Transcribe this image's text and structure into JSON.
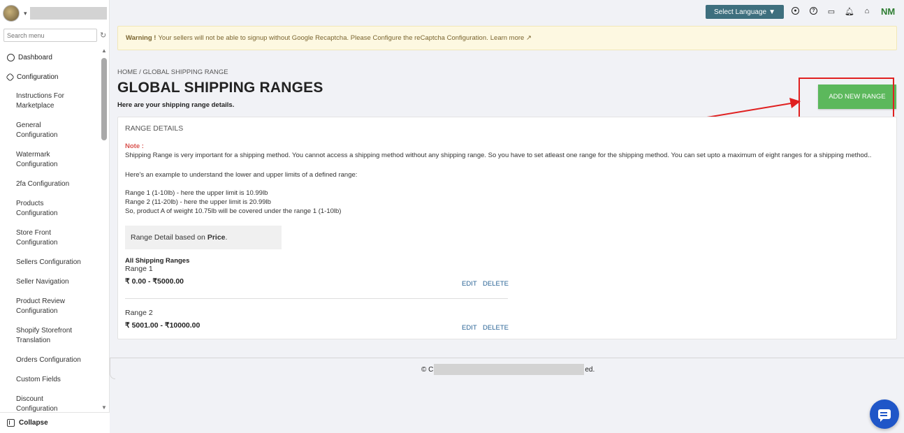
{
  "sidebar": {
    "search_placeholder": "Search menu",
    "items": [
      {
        "label": "Dashboard"
      },
      {
        "label": "Configuration"
      }
    ],
    "sub_items": [
      {
        "label": "Instructions For Marketplace",
        "lines": [
          "Instructions For",
          "Marketplace"
        ]
      },
      {
        "label": "General Configuration",
        "lines": [
          "General",
          "Configuration"
        ]
      },
      {
        "label": "Watermark Configuration",
        "lines": [
          "Watermark",
          "Configuration"
        ]
      },
      {
        "label": "2fa Configuration",
        "lines": [
          "2fa Configuration"
        ]
      },
      {
        "label": "Products Configuration",
        "lines": [
          "Products",
          "Configuration"
        ]
      },
      {
        "label": "Store Front Configuration",
        "lines": [
          "Store Front",
          "Configuration"
        ]
      },
      {
        "label": "Sellers Configuration",
        "lines": [
          "Sellers Configuration"
        ]
      },
      {
        "label": "Seller Navigation",
        "lines": [
          "Seller Navigation"
        ]
      },
      {
        "label": "Product Review Configuration",
        "lines": [
          "Product Review",
          "Configuration"
        ]
      },
      {
        "label": "Shopify Storefront Translation",
        "lines": [
          "Shopify Storefront",
          "Translation"
        ]
      },
      {
        "label": "Orders Configuration",
        "lines": [
          "Orders Configuration"
        ]
      },
      {
        "label": "Custom Fields",
        "lines": [
          "Custom Fields"
        ]
      },
      {
        "label": "Discount Configuration",
        "lines": [
          "Discount",
          "Configuration"
        ]
      }
    ],
    "collapse_label": "Collapse"
  },
  "topbar": {
    "language_label": "Select Language",
    "initials": "NM",
    "icons": [
      "account-circle-icon",
      "help-icon",
      "feedback-icon",
      "bell-icon",
      "store-icon"
    ]
  },
  "warning": {
    "strong": "Warning !",
    "text": "Your sellers will not be able to signup without Google Recaptcha. Please Configure the reCaptcha Configuration.",
    "link": "Learn more"
  },
  "page": {
    "breadcrumb_home": "HOME",
    "breadcrumb_sep": "/",
    "breadcrumb_current": "GLOBAL SHIPPING RANGE",
    "title": "GLOBAL SHIPPING RANGES",
    "subtitle": "Here are your shipping range details.",
    "add_button": "ADD NEW RANGE"
  },
  "card": {
    "title": "RANGE DETAILS",
    "note_label": "Note :",
    "note_text": "Shipping Range is very important for a shipping method. You cannot access a shipping method without any shipping range. So you have to set atleast one range for the shipping method. You can set upto a maximum of eight ranges for a shipping method..",
    "example_text": "Here's an example to understand the lower and upper limits of a defined range:",
    "example_lines": [
      "Range 1 (1-10lb) - here the upper limit is 10.99lb",
      "Range 2 (11-20lb) - here the upper limit is 20.99lb",
      "So, product A of weight 10.75lb will be covered under the range 1 (1-10lb)"
    ],
    "basis_prefix": "Range Detail based on",
    "basis_value": "Price",
    "basis_suffix": ".",
    "all_ranges_label": "All Shipping Ranges",
    "ranges": [
      {
        "name": "Range 1",
        "value": "₹ 0.00 - ₹5000.00",
        "edit": "EDIT",
        "delete": "DELETE"
      },
      {
        "name": "Range 2",
        "value": "₹ 5001.00 - ₹10000.00",
        "edit": "EDIT",
        "delete": "DELETE"
      }
    ]
  },
  "footer": {
    "prefix": "© C",
    "suffix": "ed."
  }
}
